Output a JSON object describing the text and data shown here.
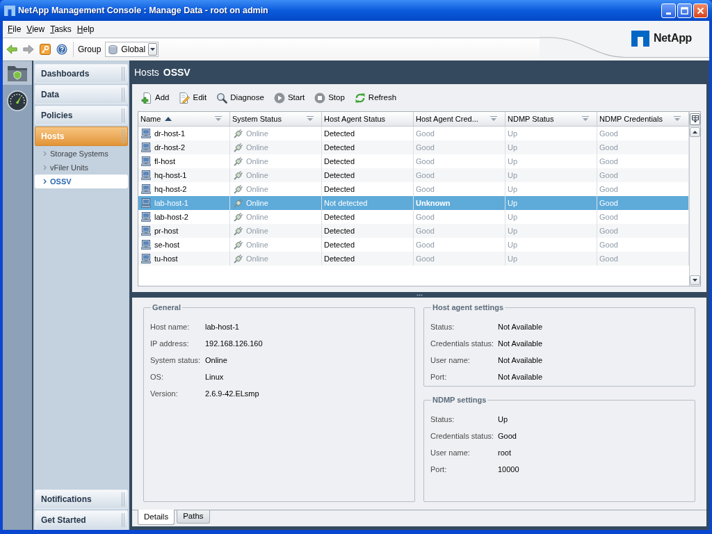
{
  "window": {
    "title": "NetApp Management Console : Manage Data - root on admin"
  },
  "menu": [
    {
      "label": "File"
    },
    {
      "label": "View"
    },
    {
      "label": "Tasks"
    },
    {
      "label": "Help"
    }
  ],
  "toolbar": {
    "group_label": "Group",
    "group_value": "Global"
  },
  "logo": {
    "text": "NetApp"
  },
  "app_icons": [
    {
      "kind": "folder",
      "selected": true
    },
    {
      "kind": "gauge",
      "selected": false
    }
  ],
  "nav": {
    "items": [
      {
        "label": "Dashboards",
        "selected": false
      },
      {
        "label": "Data",
        "selected": false
      },
      {
        "label": "Policies",
        "selected": false
      },
      {
        "label": "Hosts",
        "selected": true,
        "children": [
          {
            "label": "Storage Systems",
            "selected": false
          },
          {
            "label": "vFiler Units",
            "selected": false
          },
          {
            "label": "OSSV",
            "selected": true
          }
        ]
      }
    ],
    "bottom_items": [
      {
        "label": "Notifications",
        "selected": false
      },
      {
        "label": "Get Started",
        "selected": false
      }
    ]
  },
  "page": {
    "section": "Hosts",
    "title": "OSSV"
  },
  "actions": [
    {
      "label": "Add",
      "kind": "add"
    },
    {
      "label": "Edit",
      "kind": "edit"
    },
    {
      "label": "Diagnose",
      "kind": "diagnose"
    },
    {
      "label": "Start",
      "kind": "start"
    },
    {
      "label": "Stop",
      "kind": "stop"
    },
    {
      "label": "Refresh",
      "kind": "refresh"
    }
  ],
  "table": {
    "columns": [
      {
        "label": "Name",
        "kind": "host",
        "muted": false,
        "sorted": true,
        "filter": true
      },
      {
        "label": "System Status",
        "kind": "status",
        "muted": true,
        "sorted": false,
        "filter": true
      },
      {
        "label": "Host Agent Status",
        "kind": "text",
        "muted": false,
        "sorted": false,
        "filter": false
      },
      {
        "label": "Host Agent Cred...",
        "kind": "credentials",
        "muted": true,
        "sorted": false,
        "filter": true
      },
      {
        "label": "NDMP Status",
        "kind": "text",
        "muted": true,
        "sorted": false,
        "filter": true
      },
      {
        "label": "NDMP Credentials",
        "kind": "text",
        "muted": true,
        "sorted": false,
        "filter": true
      }
    ],
    "rows": [
      {
        "cells": [
          "dr-host-1",
          "Online",
          "Detected",
          "Good",
          "Up",
          "Good"
        ],
        "selected": false,
        "alert": false
      },
      {
        "cells": [
          "dr-host-2",
          "Online",
          "Detected",
          "Good",
          "Up",
          "Good"
        ],
        "selected": false,
        "alert": false
      },
      {
        "cells": [
          "fl-host",
          "Online",
          "Detected",
          "Good",
          "Up",
          "Good"
        ],
        "selected": false,
        "alert": false
      },
      {
        "cells": [
          "hq-host-1",
          "Online",
          "Detected",
          "Good",
          "Up",
          "Good"
        ],
        "selected": false,
        "alert": false
      },
      {
        "cells": [
          "hq-host-2",
          "Online",
          "Detected",
          "Good",
          "Up",
          "Good"
        ],
        "selected": false,
        "alert": false
      },
      {
        "cells": [
          "lab-host-1",
          "Online",
          "Not detected",
          "Unknown",
          "Up",
          "Good"
        ],
        "selected": true,
        "alert": true
      },
      {
        "cells": [
          "lab-host-2",
          "Online",
          "Detected",
          "Good",
          "Up",
          "Good"
        ],
        "selected": false,
        "alert": false
      },
      {
        "cells": [
          "pr-host",
          "Online",
          "Detected",
          "Good",
          "Up",
          "Good"
        ],
        "selected": false,
        "alert": false
      },
      {
        "cells": [
          "se-host",
          "Online",
          "Detected",
          "Good",
          "Up",
          "Good"
        ],
        "selected": false,
        "alert": false
      },
      {
        "cells": [
          "tu-host",
          "Online",
          "Detected",
          "Good",
          "Up",
          "Good"
        ],
        "selected": false,
        "alert": false
      }
    ]
  },
  "details": {
    "general": {
      "title": "General",
      "fields": [
        {
          "label": "Host name:",
          "value": "lab-host-1"
        },
        {
          "label": "IP address:",
          "value": "192.168.126.160"
        },
        {
          "label": "System status:",
          "value": "Online"
        },
        {
          "label": "OS:",
          "value": "Linux"
        },
        {
          "label": "Version:",
          "value": "2.6.9-42.ELsmp"
        }
      ]
    },
    "settings": [
      {
        "title": "Host agent settings",
        "fields": [
          {
            "label": "Status:",
            "value": "Not Available"
          },
          {
            "label": "Credentials status:",
            "value": "Not Available"
          },
          {
            "label": "User name:",
            "value": "Not Available"
          },
          {
            "label": "Port:",
            "value": "Not Available"
          }
        ]
      },
      {
        "title": "NDMP settings",
        "fields": [
          {
            "label": "Status:",
            "value": "Up"
          },
          {
            "label": "Credentials status:",
            "value": "Good"
          },
          {
            "label": "User name:",
            "value": "root"
          },
          {
            "label": "Port:",
            "value": "10000"
          }
        ]
      }
    ]
  },
  "tabs": [
    {
      "label": "Details",
      "selected": true
    },
    {
      "label": "Paths",
      "selected": false
    }
  ]
}
